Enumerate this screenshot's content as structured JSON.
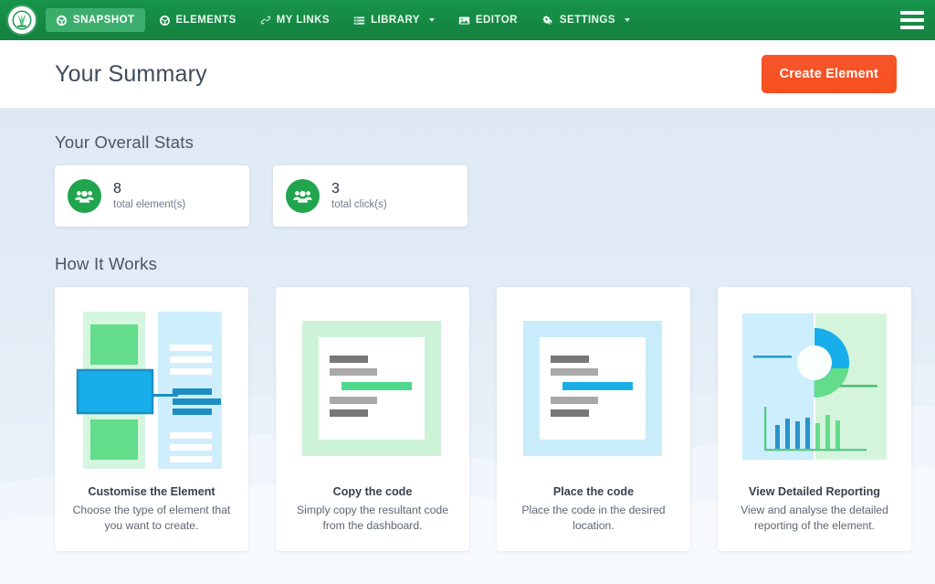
{
  "navbar": {
    "logo_icon": "plant-logo-icon",
    "menu_icon": "hamburger-menu-icon",
    "items": [
      {
        "label": "SNAPSHOT",
        "icon": "dashcube-icon",
        "active": true,
        "caret": false
      },
      {
        "label": "ELEMENTS",
        "icon": "dashcube-icon",
        "active": false,
        "caret": false
      },
      {
        "label": "MY LINKS",
        "icon": "link-chain-icon",
        "active": false,
        "caret": false
      },
      {
        "label": "LIBRARY",
        "icon": "list-bars-icon",
        "active": false,
        "caret": true
      },
      {
        "label": "EDITOR",
        "icon": "image-icon",
        "active": false,
        "caret": false
      },
      {
        "label": "SETTINGS",
        "icon": "gears-icon",
        "active": false,
        "caret": true
      }
    ]
  },
  "header": {
    "title": "Your Summary",
    "create_button": "Create Element"
  },
  "stats": {
    "section_title": "Your Overall Stats",
    "items": [
      {
        "value": "8",
        "label": "total element(s)",
        "icon": "users-group-icon"
      },
      {
        "value": "3",
        "label": "total click(s)",
        "icon": "users-group-icon"
      }
    ]
  },
  "how_it_works": {
    "section_title": "How It Works",
    "cards": [
      {
        "illustration": "customise-element-illustration",
        "title": "Customise the Element",
        "text": "Choose the type of element that you want to create."
      },
      {
        "illustration": "copy-code-illustration",
        "title": "Copy the code",
        "text": "Simply copy the resultant code from the dashboard."
      },
      {
        "illustration": "place-code-illustration",
        "title": "Place the code",
        "text": "Place the code in the desired location."
      },
      {
        "illustration": "detailed-reporting-illustration",
        "title": "View Detailed Reporting",
        "text": "View and analyse the detailed reporting of the element."
      }
    ]
  },
  "colors": {
    "navbar_green": "#17944b",
    "nav_active_green": "#3cae6c",
    "accent_orange": "#f4501f",
    "stat_icon_green": "#21a44e",
    "illus_blue": "#18aeeb",
    "illus_green": "#63dd8a",
    "page_bg": "#e2ecf6"
  }
}
